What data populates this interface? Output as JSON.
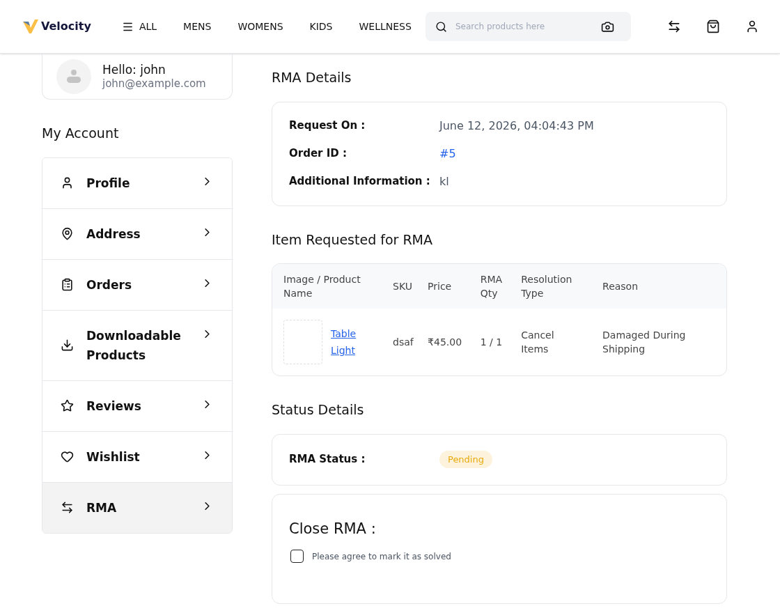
{
  "header": {
    "logo": "Velocity",
    "nav": [
      {
        "label": "ALL",
        "kind": "menu"
      },
      {
        "label": "MENS",
        "kind": "link"
      },
      {
        "label": "WOMENS",
        "kind": "link"
      },
      {
        "label": "KIDS",
        "kind": "link"
      },
      {
        "label": "WELLNESS",
        "kind": "link"
      }
    ],
    "search": {
      "placeholder": "Search products here"
    }
  },
  "profile": {
    "greeting": "Hello: john",
    "email": "john@example.com"
  },
  "account": {
    "title": "My Account",
    "items": [
      {
        "label": "Profile",
        "selected": false
      },
      {
        "label": "Address",
        "selected": false
      },
      {
        "label": "Orders",
        "selected": false
      },
      {
        "label": "Downloadable Products",
        "selected": false
      },
      {
        "label": "Reviews",
        "selected": false
      },
      {
        "label": "Wishlist",
        "selected": false
      },
      {
        "label": "RMA",
        "selected": true
      }
    ]
  },
  "rma_details": {
    "title": "RMA Details",
    "fields": [
      {
        "label": "Request On :",
        "value": "June 12, 2026, 04:04:43 PM",
        "kind": "text"
      },
      {
        "label": "Order ID :",
        "value": "#5",
        "kind": "link"
      },
      {
        "label": "Additional Information :",
        "value": "kl",
        "kind": "text"
      }
    ]
  },
  "items": {
    "title": "Item Requested for RMA",
    "columns": [
      "Image / Product Name",
      "SKU",
      "Price",
      "RMA Qty",
      "Resolution Type",
      "Reason"
    ],
    "rows": [
      {
        "product": "Table Light",
        "sku": "dsaf",
        "price": "₹45.00",
        "qty": "1 / 1",
        "resolution": "Cancel Items",
        "reason": "Damaged During Shipping"
      }
    ]
  },
  "status": {
    "title": "Status Details",
    "label": "RMA Status :",
    "value": "Pending"
  },
  "close": {
    "title": "Close RMA :",
    "checkbox": {
      "label": "Please agree to mark it as solved",
      "checked": false
    }
  }
}
